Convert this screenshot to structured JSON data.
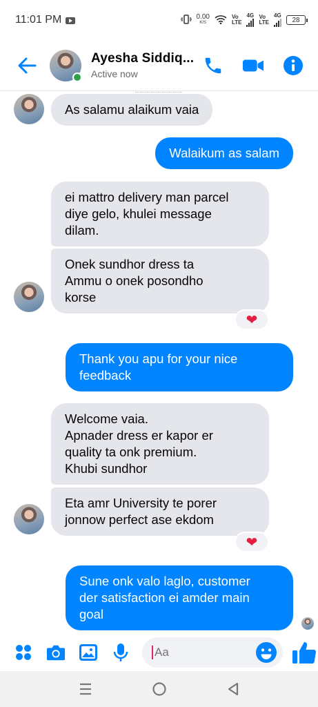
{
  "status_bar": {
    "time": "11:01 PM",
    "net_speed": "0.00",
    "net_speed_unit": "K/S",
    "sim1_label": "Vo",
    "sim1_sub": "LTE",
    "sim1_gen": "4G",
    "sim2_label": "Vo",
    "sim2_sub": "LTE",
    "sim2_gen": "4G",
    "battery": "28"
  },
  "header": {
    "contact_name": "Ayesha Siddiq...",
    "contact_status": "Active now",
    "icons": [
      "back-arrow-icon",
      "phone-icon",
      "video-camera-icon",
      "info-icon"
    ],
    "accent_color": "#0084ff"
  },
  "messages": [
    {
      "side": "in",
      "text": "As salamu alaikum vaia"
    },
    {
      "side": "out",
      "text": "Walaikum as salam"
    },
    {
      "side": "in",
      "text": "ei mattro delivery man parcel\ndiye gelo, khulei message\ndilam."
    },
    {
      "side": "in",
      "text": "Onek sundhor dress ta\nAmmu o onek posondho\nkorse",
      "reaction": "❤"
    },
    {
      "side": "out",
      "text": "Thank you apu for your nice\nfeedback"
    },
    {
      "side": "in",
      "text": "Welcome vaia.\nApnader dress er kapor er\nquality ta onk premium.\nKhubi sundhor"
    },
    {
      "side": "in",
      "text": "Eta amr University te porer\njonnow perfect ase ekdom",
      "reaction": "❤"
    },
    {
      "side": "out",
      "text": "Sune onk valo laglo, customer\nder satisfaction ei amder main\ngoal"
    }
  ],
  "composer": {
    "placeholder": "Aa",
    "icons": [
      "apps-grid-icon",
      "camera-icon",
      "gallery-icon",
      "microphone-icon",
      "emoji-icon",
      "thumbs-up-icon"
    ]
  },
  "navbar": {
    "icons": [
      "recents-icon",
      "home-icon",
      "back-triangle-icon"
    ]
  }
}
